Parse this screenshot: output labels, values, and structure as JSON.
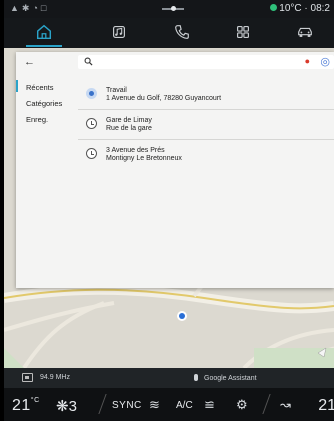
{
  "status": {
    "temperature": "10°C",
    "time": "08:2"
  },
  "nav": {
    "items": [
      "home-icon",
      "music-icon",
      "phone-icon",
      "apps-icon",
      "car-icon"
    ],
    "active": "home"
  },
  "search_panel": {
    "sidebar": {
      "items": [
        {
          "label": "Récents"
        },
        {
          "label": "Catégories"
        },
        {
          "label": "Enreg."
        }
      ]
    },
    "search": {
      "placeholder": ""
    },
    "results": [
      {
        "icon": "work",
        "line1": "Travail",
        "line2": "1 Avenue du Golf, 78280 Guyancourt"
      },
      {
        "icon": "history",
        "line1": "Gare de Limay",
        "line2": "Rue de la gare"
      },
      {
        "icon": "history",
        "line1": "3 Avenue des Prés",
        "line2": "Montigny Le Bretonneux"
      }
    ]
  },
  "radio": {
    "frequency": "94.9 MHz",
    "assistant": "Google Assistant"
  },
  "climate": {
    "temp_left": "21",
    "temp_left_unit": "°C",
    "fan_level": "3",
    "sync_label": "SYNC",
    "ac_label": "A/C",
    "temp_right": "21"
  },
  "colors": {
    "accent": "#2aa3c9",
    "status_dot": "#2fc07a",
    "mic": "#d93a2b"
  }
}
